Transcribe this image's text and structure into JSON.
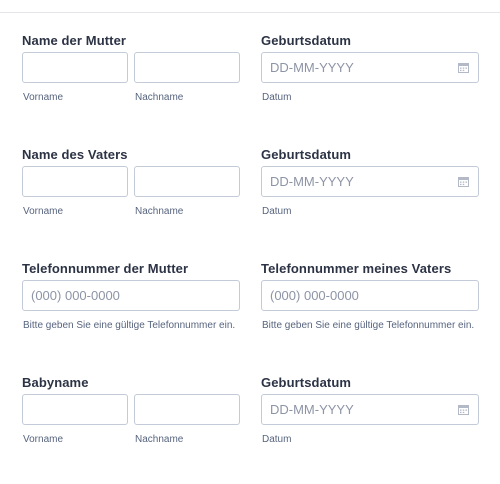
{
  "rows": [
    {
      "left": {
        "label": "Name der Mutter",
        "first_sublabel": "Vorname",
        "last_sublabel": "Nachname"
      },
      "right": {
        "label": "Geburtsdatum",
        "placeholder": "DD-MM-YYYY",
        "sublabel": "Datum"
      }
    },
    {
      "left": {
        "label": "Name des Vaters",
        "first_sublabel": "Vorname",
        "last_sublabel": "Nachname"
      },
      "right": {
        "label": "Geburtsdatum",
        "placeholder": "DD-MM-YYYY",
        "sublabel": "Datum"
      }
    },
    {
      "left": {
        "label": "Telefonnummer der Mutter",
        "placeholder": "(000) 000-0000",
        "sublabel": "Bitte geben Sie eine gültige Telefonnummer ein."
      },
      "right": {
        "label": "Telefonnummer meines Vaters",
        "placeholder": "(000) 000-0000",
        "sublabel": "Bitte geben Sie eine gültige Telefonnummer ein."
      }
    },
    {
      "left": {
        "label": "Babyname",
        "first_sublabel": "Vorname",
        "last_sublabel": "Nachname"
      },
      "right": {
        "label": "Geburtsdatum",
        "placeholder": "DD-MM-YYYY",
        "sublabel": "Datum"
      }
    }
  ],
  "icons": {
    "date_picker": "calendar-icon"
  },
  "colors": {
    "field_border": "#c3cad8",
    "label_text": "#2c3345",
    "placeholder_text": "#8d94a5",
    "sublabel_text": "#57647e"
  }
}
